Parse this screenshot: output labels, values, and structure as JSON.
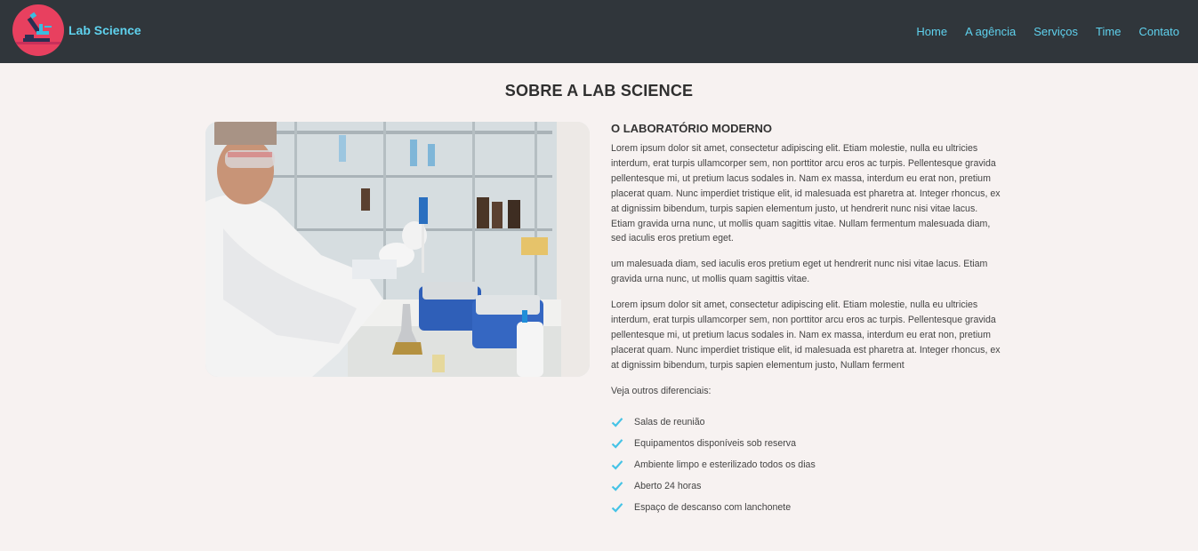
{
  "header": {
    "brand": "Lab Science",
    "nav": [
      "Home",
      "A agência",
      "Serviços",
      "Time",
      "Contato"
    ]
  },
  "section": {
    "title": "SOBRE A LAB SCIENCE",
    "subtitle": "O LABORATÓRIO MODERNO",
    "paragraphs": [
      "Lorem ipsum dolor sit amet, consectetur adipiscing elit. Etiam molestie, nulla eu ultricies interdum, erat turpis ullamcorper sem, non porttitor arcu eros ac turpis. Pellentesque gravida pellentesque mi, ut pretium lacus sodales in. Nam ex massa, interdum eu erat non, pretium placerat quam. Nunc imperdiet tristique elit, id malesuada est pharetra at. Integer rhoncus, ex at dignissim bibendum, turpis sapien elementum justo, ut hendrerit nunc nisi vitae lacus. Etiam gravida urna nunc, ut mollis quam sagittis vitae. Nullam fermentum malesuada diam, sed iaculis eros pretium eget.",
      "um malesuada diam, sed iaculis eros pretium eget ut hendrerit nunc nisi vitae lacus. Etiam gravida urna nunc, ut mollis quam sagittis vitae.",
      "Lorem ipsum dolor sit amet, consectetur adipiscing elit. Etiam molestie, nulla eu ultricies interdum, erat turpis ullamcorper sem, non porttitor arcu eros ac turpis. Pellentesque gravida pellentesque mi, ut pretium lacus sodales in. Nam ex massa, interdum eu erat non, pretium placerat quam. Nunc imperdiet tristique elit, id malesuada est pharetra at. Integer rhoncus, ex at dignissim bibendum, turpis sapien elementum justo, Nullam ferment",
      "Veja outros diferenciais:"
    ],
    "features": [
      "Salas de reunião",
      "Equipamentos disponíveis sob reserva",
      "Ambiente limpo e esterilizado todos os dias",
      "Aberto 24 horas",
      "Espaço de descanso com lanchonete"
    ]
  },
  "colors": {
    "header_bg": "#30363b",
    "accent": "#5fd2ee",
    "logo_bg": "#e8405f",
    "page_bg": "#f7f2f1"
  },
  "icons": {
    "logo": "microscope-icon",
    "feature": "check-icon"
  }
}
